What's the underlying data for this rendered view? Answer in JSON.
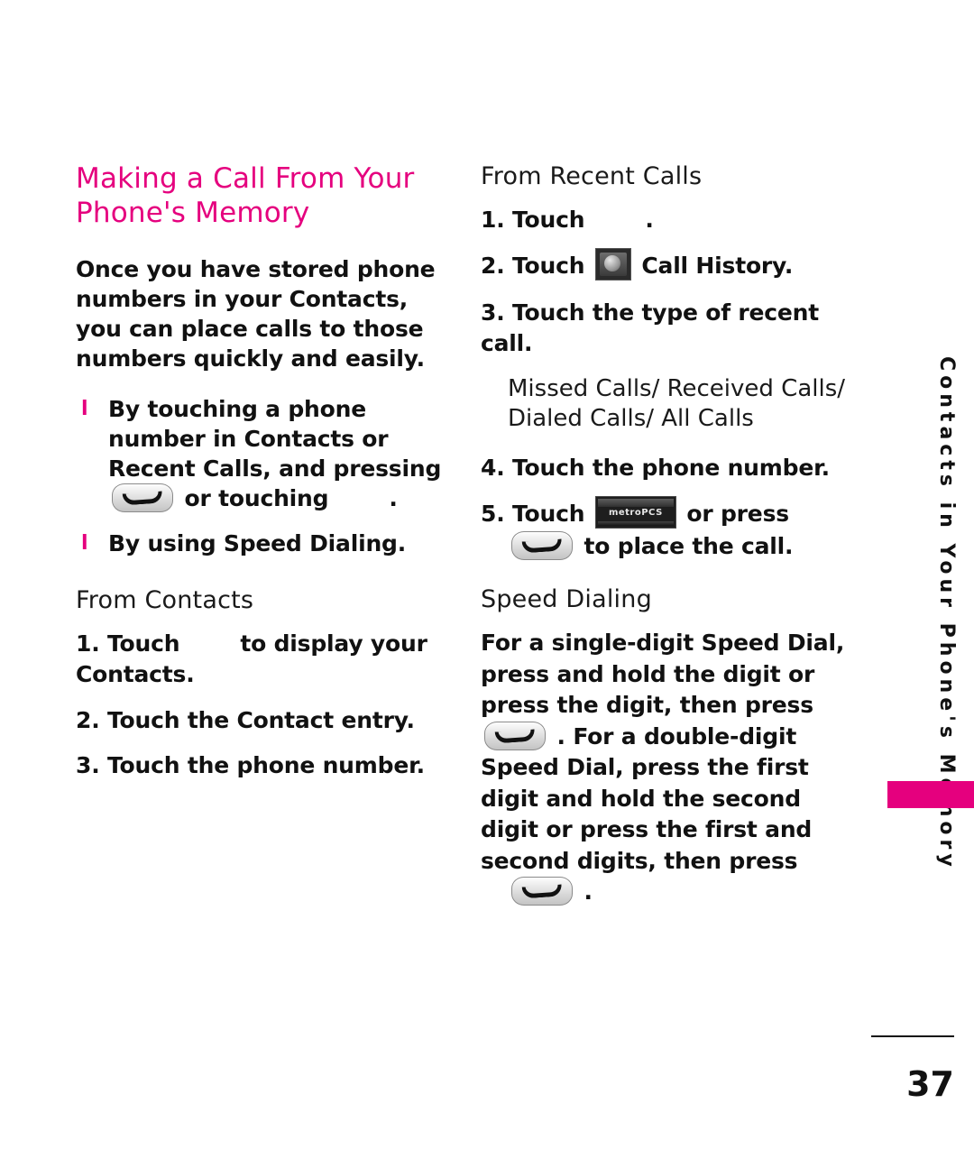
{
  "document": {
    "page_number": "37",
    "side_tab_text": "Contacts in Your Phone's Memory"
  },
  "left_column": {
    "title": "Making a Call From Your Phone's Memory",
    "intro": "Once you have stored phone numbers in your Contacts, you can place calls to those numbers quickly and easily.",
    "bullets": [
      {
        "text_before": "By touching a phone number in Contacts or Recent Calls, and pressing",
        "icon": "send-key-icon",
        "text_after": "or touching",
        "icon2": "blank-key-icon",
        "text_end": "."
      },
      {
        "text_before": "By using Speed Dialing.",
        "icon": "",
        "text_after": "",
        "icon2": "",
        "text_end": ""
      }
    ],
    "section_heading": "From Contacts",
    "steps": [
      {
        "number": "1.",
        "text_before": "Touch",
        "icon": "blank-key-icon",
        "text_after": "to display your Contacts."
      },
      {
        "number": "2.",
        "text_before": "Touch the Contact entry.",
        "icon": "",
        "text_after": ""
      },
      {
        "number": "3.",
        "text_before": "Touch the phone number.",
        "icon": "",
        "text_after": ""
      }
    ]
  },
  "right_column": {
    "section_heading_1": "From Recent Calls",
    "steps": [
      {
        "number": "1.",
        "text_before": "Touch",
        "icon": "blank-key-icon",
        "text_after": "."
      },
      {
        "number": "2.",
        "text_before": "Touch",
        "icon": "menu-key-icon",
        "text_after": "Call History."
      },
      {
        "number": "3.",
        "text_before": "Touch the type of recent call.",
        "icon": "",
        "text_after": ""
      }
    ],
    "call_types_note": "Missed Calls/ Received Calls/ Dialed Calls/ All Calls",
    "steps_2": [
      {
        "number": "4.",
        "text_before": "Touch the phone number.",
        "icon": "",
        "text_after": ""
      },
      {
        "number": "5.",
        "text_before": "Touch",
        "icon": "metro-key-icon",
        "text_after": "or press",
        "icon2": "send-key-icon",
        "text_end": "to place the call."
      }
    ],
    "section_heading_2": "Speed Dialing",
    "speed_dialing_part1": "For a single-digit Speed Dial, press and hold the digit or press the digit, then press",
    "speed_dialing_part2": ". For a double-digit Speed Dial, press the first digit and hold the second digit or press the first and second digits, then press",
    "speed_dialing_part3": "."
  },
  "icons": {
    "metro_label_line1": "metroPCS",
    "send_key": "send-key-icon",
    "menu_key": "menu-key-icon",
    "blank_key": "blank-key-icon"
  },
  "colors": {
    "accent": "#E5007E",
    "text": "#111111"
  }
}
